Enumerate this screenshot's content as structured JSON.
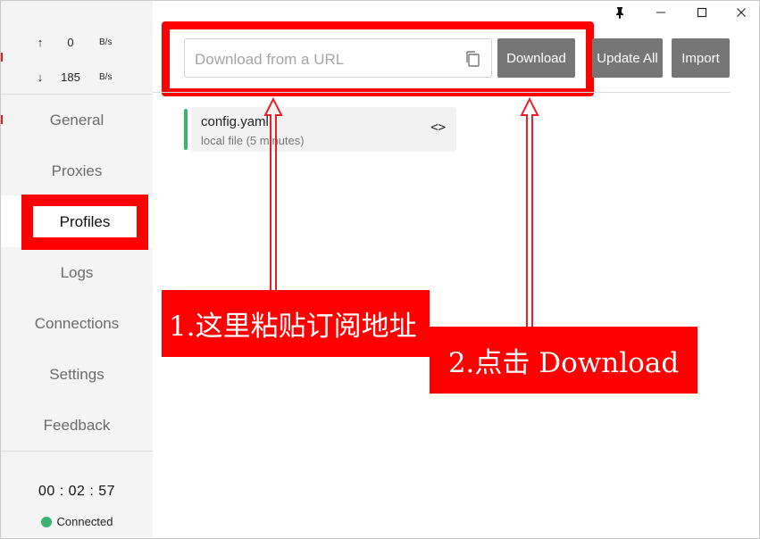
{
  "sidebar": {
    "traffic": {
      "up_symbol": "↑",
      "up_value": "0",
      "up_unit": "B/s",
      "down_symbol": "↓",
      "down_value": "185",
      "down_unit": "B/s"
    },
    "nav": {
      "general": "General",
      "proxies": "Proxies",
      "profiles": "Profiles",
      "logs": "Logs",
      "connections": "Connections",
      "settings": "Settings",
      "feedback": "Feedback"
    },
    "clock": "00 : 02 : 57",
    "status": "Connected"
  },
  "toolbar": {
    "url_placeholder": "Download from a URL",
    "download_label": "Download",
    "update_all_label": "Update All",
    "import_label": "Import"
  },
  "profiles": [
    {
      "name": "config.yaml",
      "desc": "local file (5 minutes)"
    }
  ],
  "annotations": {
    "step1": "1.这里粘贴订阅地址",
    "step2": "2.点击 Download"
  },
  "colors": {
    "highlight_red": "#ff0000",
    "button_gray": "#767676",
    "connected_green": "#3cb371"
  }
}
